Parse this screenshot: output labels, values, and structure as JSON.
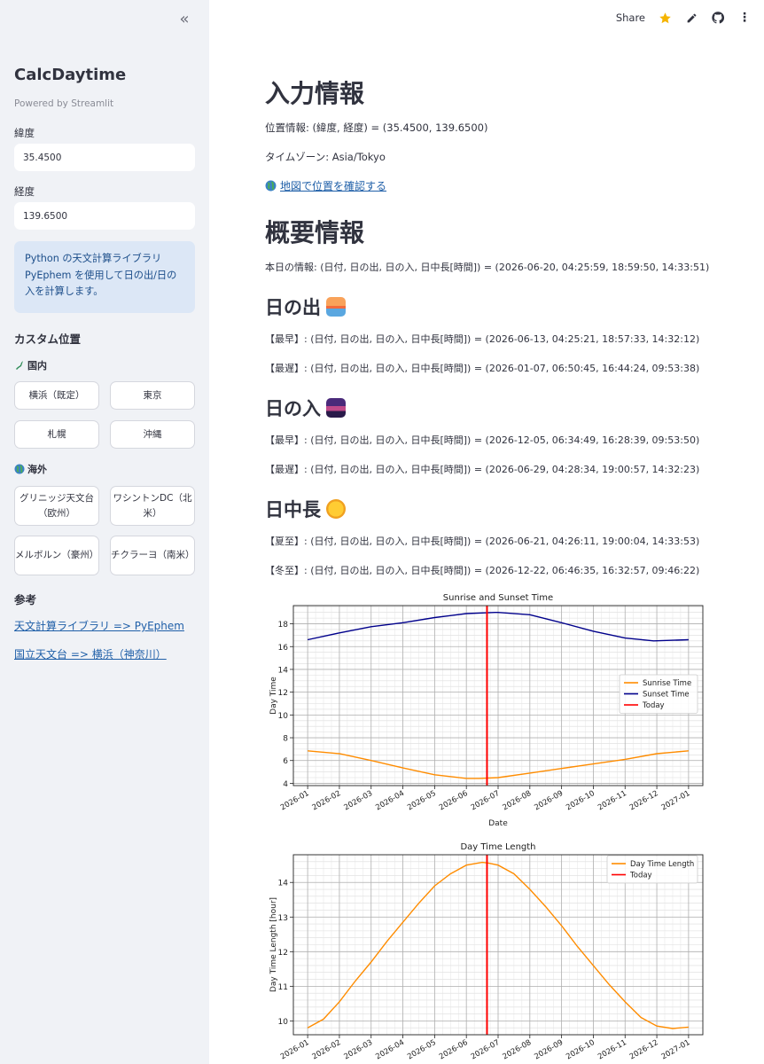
{
  "sidebar": {
    "title": "CalcDaytime",
    "powered": "Powered by Streamlit",
    "lat_label": "緯度",
    "lat_value": "35.4500",
    "lon_label": "経度",
    "lon_value": "139.6500",
    "info": "Python の天文計算ライブラリ PyEphem を使用して日の出/日の入を計算します。",
    "custom_heading": "カスタム位置",
    "domestic": "国内",
    "domestic_buttons": [
      "横浜（既定）",
      "東京",
      "札幌",
      "沖縄"
    ],
    "overseas": "海外",
    "overseas_buttons": [
      "グリニッジ天文台（欧州）",
      "ワシントンDC（北米）",
      "メルボルン（豪州）",
      "チクラーヨ（南米）"
    ],
    "ref_heading": "参考",
    "links": [
      "天文計算ライブラリ => PyEphem",
      "国立天文台 => 横浜（神奈川）"
    ]
  },
  "toolbar": {
    "share": "Share"
  },
  "main": {
    "h_input": "入力情報",
    "position": "位置情報: (緯度, 経度) = (35.4500, 139.6500)",
    "timezone": "タイムゾーン: Asia/Tokyo",
    "map_link": "地図で位置を確認する",
    "h_summary": "概要情報",
    "today": "本日の情報: (日付, 日の出, 日の入, 日中長[時間]) = (2026-06-20, 04:25:59, 18:59:50, 14:33:51)",
    "h_sunrise": "日の出",
    "sunrise_earliest": "【最早】: (日付, 日の出, 日の入, 日中長[時間]) = (2026-06-13, 04:25:21, 18:57:33, 14:32:12)",
    "sunrise_latest": "【最遅】: (日付, 日の出, 日の入, 日中長[時間]) = (2026-01-07, 06:50:45, 16:44:24, 09:53:38)",
    "h_sunset": "日の入",
    "sunset_earliest": "【最早】: (日付, 日の出, 日の入, 日中長[時間]) = (2026-12-05, 06:34:49, 16:28:39, 09:53:50)",
    "sunset_latest": "【最遅】: (日付, 日の出, 日の入, 日中長[時間]) = (2026-06-29, 04:28:34, 19:00:57, 14:32:23)",
    "h_daylength": "日中長",
    "summer_solstice": "【夏至】: (日付, 日の出, 日の入, 日中長[時間]) = (2026-06-21, 04:26:11, 19:00:04, 14:33:53)",
    "winter_solstice": "【冬至】: (日付, 日の出, 日の入, 日中長[時間]) = (2026-12-22, 06:46:35, 16:32:57, 09:46:22)"
  },
  "chart_data": [
    {
      "type": "line",
      "title": "Sunrise and Sunset Time",
      "xlabel": "Date",
      "ylabel": "Day Time",
      "x_ticks": [
        "2026-01",
        "2026-02",
        "2026-03",
        "2026-04",
        "2026-05",
        "2026-06",
        "2026-07",
        "2026-08",
        "2026-09",
        "2026-10",
        "2026-11",
        "2026-12",
        "2027-01"
      ],
      "ylim": [
        3.8,
        19.6
      ],
      "y_ticks": [
        4,
        6,
        8,
        10,
        12,
        14,
        16,
        18
      ],
      "grid": true,
      "legend": "center-right",
      "today_x": 5.65,
      "series": [
        {
          "name": "Sunrise Time",
          "color": "#ff8c00",
          "x": [
            0,
            1,
            2,
            3,
            4,
            5,
            5.4,
            6,
            7,
            8,
            9,
            10,
            11,
            12
          ],
          "y": [
            6.85,
            6.6,
            6.0,
            5.35,
            4.75,
            4.43,
            4.43,
            4.5,
            4.9,
            5.3,
            5.7,
            6.1,
            6.6,
            6.85
          ]
        },
        {
          "name": "Sunset Time",
          "color": "#00008b",
          "x": [
            0,
            1,
            2,
            3,
            4,
            5,
            5.9,
            6,
            7,
            8,
            9,
            10,
            10.9,
            12
          ],
          "y": [
            16.6,
            17.2,
            17.75,
            18.1,
            18.55,
            18.9,
            19.0,
            19.0,
            18.8,
            18.1,
            17.35,
            16.75,
            16.5,
            16.6
          ]
        },
        {
          "name": "Today",
          "color": "#ff0000"
        }
      ]
    },
    {
      "type": "line",
      "title": "Day Time Length",
      "ylabel": "Day Time Length [hour]",
      "x_ticks": [
        "2026-01",
        "2026-02",
        "2026-03",
        "2026-04",
        "2026-05",
        "2026-06",
        "2026-07",
        "2026-08",
        "2026-09",
        "2026-10",
        "2026-11",
        "2026-12",
        "2027-01"
      ],
      "ylim": [
        9.6,
        14.8
      ],
      "y_ticks": [
        10,
        11,
        12,
        13,
        14
      ],
      "grid": true,
      "legend": "top-right",
      "today_x": 5.65,
      "series": [
        {
          "name": "Day Time Length",
          "color": "#ff8c00",
          "x": [
            0,
            0.5,
            1,
            1.5,
            2,
            2.5,
            3,
            3.5,
            4,
            4.5,
            5,
            5.5,
            5.7,
            6,
            6.5,
            7,
            7.5,
            8,
            8.5,
            9,
            9.5,
            10,
            10.5,
            11,
            11.5,
            12
          ],
          "y": [
            9.8,
            10.05,
            10.55,
            11.15,
            11.7,
            12.3,
            12.85,
            13.4,
            13.9,
            14.25,
            14.5,
            14.58,
            14.56,
            14.5,
            14.25,
            13.8,
            13.3,
            12.75,
            12.15,
            11.6,
            11.05,
            10.55,
            10.1,
            9.85,
            9.78,
            9.82
          ]
        },
        {
          "name": "Today",
          "color": "#ff0000"
        }
      ]
    }
  ]
}
